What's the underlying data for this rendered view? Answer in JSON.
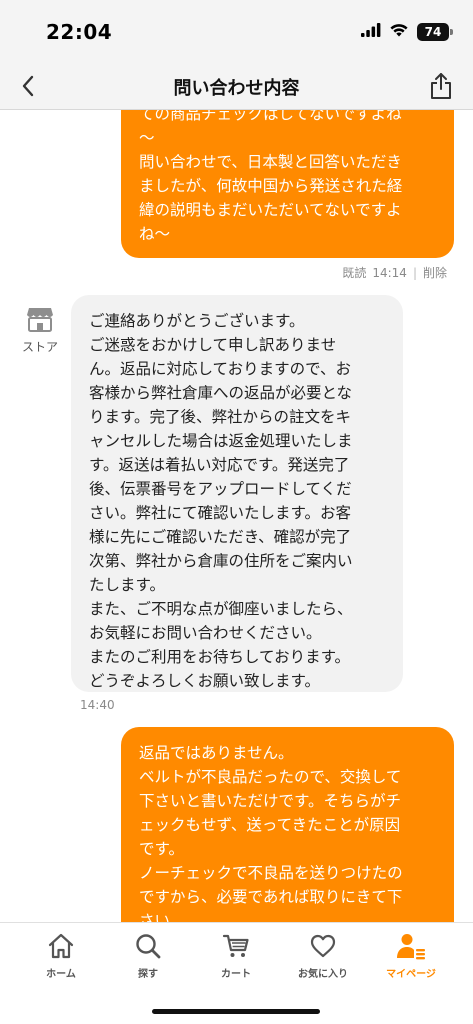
{
  "status_bar": {
    "time": "22:04",
    "battery": "74",
    "icons": [
      "signal-icon",
      "wifi-icon",
      "battery-icon"
    ]
  },
  "nav": {
    "title": "問い合わせ内容",
    "back_icon": "chevron-left-icon",
    "share_icon": "share-icon"
  },
  "messages": {
    "user_first": {
      "lines": [
        "ての商品チェックはしてないですよね",
        "〜",
        "問い合わせで、日本製と回答いただき",
        "ましたが、何故中国から発送された経",
        "緯の説明もまだいただいてないですよ",
        "ね〜"
      ],
      "read_label": "既読",
      "time": "14:14",
      "delete_label": "削除"
    },
    "store": {
      "sender_label": "ストア",
      "sender_icon": "store-icon",
      "lines": [
        "ご連絡ありがとうございます。",
        "ご迷惑をおかけして申し訳ありませ",
        "ん。返品に対応しておりますので、お",
        "客様から弊社倉庫への返品が必要とな",
        "ります。完了後、弊社からの註文をキ",
        "ャンセルした場合は返金処理いたしま",
        "す。返送は着払い対応です。発送完了",
        "後、伝票番号をアップロードしてくだ",
        "さい。弊社にて確認いたします。お客",
        "様に先にご確認いただき、確認が完了",
        "次第、弊社から倉庫の住所をご案内い",
        "たします。",
        "また、ご不明な点が御座いましたら、",
        "お気軽にお問い合わせください。",
        "またのご利用をお待ちしております。",
        "どうぞよろしくお願い致します。"
      ],
      "time": "14:40"
    },
    "user_last": {
      "lines": [
        "返品ではありません。",
        "ベルトが不良品だったので、交換して",
        "下さいと書いただけです。そちらがチ",
        "ェックもせず、送ってきたことが原因",
        "です。",
        "ノーチェックで不良品を送りつけたの",
        "ですから、必要であれば取りにきて下",
        "さい。"
      ]
    }
  },
  "tabs": [
    {
      "label": "ホーム",
      "icon": "home-icon",
      "active": false
    },
    {
      "label": "探す",
      "icon": "search-icon",
      "active": false
    },
    {
      "label": "カート",
      "icon": "cart-icon",
      "active": false
    },
    {
      "label": "お気に入り",
      "icon": "heart-icon",
      "active": false
    },
    {
      "label": "マイページ",
      "icon": "person-icon",
      "active": true
    }
  ],
  "colors": {
    "accent": "#ff8a00",
    "store_bubble": "#f2f2f2",
    "meta_text": "#8a8a8a"
  }
}
